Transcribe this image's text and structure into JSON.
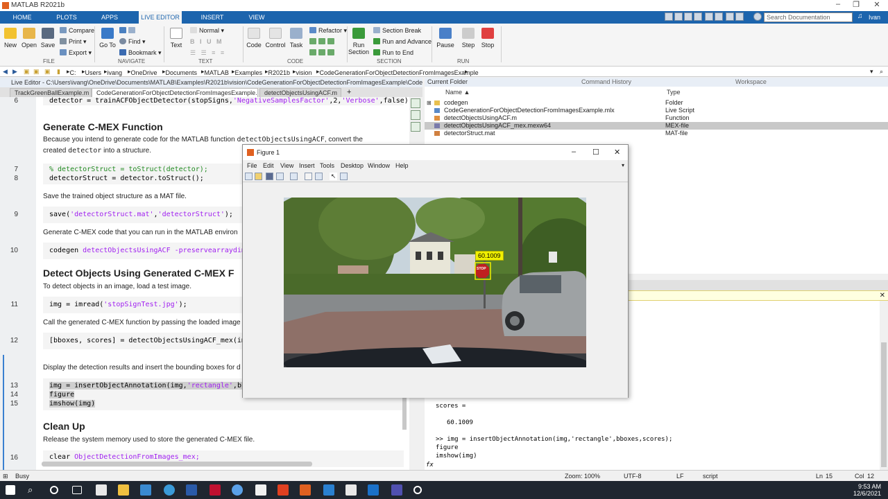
{
  "window": {
    "title": "MATLAB R2021b"
  },
  "ribbon_tabs": [
    "HOME",
    "PLOTS",
    "APPS",
    "LIVE EDITOR",
    "INSERT",
    "VIEW"
  ],
  "search_placeholder": "Search Documentation",
  "user": "Ivan",
  "ribbon": {
    "file": {
      "new": "New",
      "open": "Open",
      "save": "Save",
      "compare": "Compare",
      "print": "Print",
      "export": "Export",
      "group": "FILE"
    },
    "navigate": {
      "goto": "Go To",
      "find": "Find",
      "bookmark": "Bookmark",
      "group": "NAVIGATE"
    },
    "text": {
      "style": "Normal",
      "label": "Text",
      "group": "TEXT"
    },
    "code": {
      "code": "Code",
      "control": "Control",
      "task": "Task",
      "refactor": "Refactor",
      "group": "CODE"
    },
    "section": {
      "run_section": "Run Section",
      "section_break": "Section Break",
      "run_advance": "Run and Advance",
      "run_end": "Run to End",
      "group": "SECTION"
    },
    "run": {
      "pause": "Pause",
      "step": "Step",
      "stop": "Stop",
      "group": "RUN"
    }
  },
  "address_path": [
    "C:",
    "Users",
    "ivang",
    "OneDrive",
    "Documents",
    "MATLAB",
    "Examples",
    "R2021b",
    "vision",
    "CodeGenerationForObjectDetectionFromImagesExample"
  ],
  "editor": {
    "title": "Live Editor - C:\\Users\\ivang\\OneDrive\\Documents\\MATLAB\\Examples\\R2021b\\vision\\CodeGenerationForObjectDetectionFromImagesExample\\CodeGenerati...",
    "tabs": [
      "TrackGreenBallExample.m",
      "CodeGenerationForObjectDetectionFromImagesExample.mlx",
      "detectObjectsUsingACF.m"
    ],
    "line6": "detector = trainACFObjectDetector(stopSigns,",
    "line6_s1": "'NegativeSamplesFactor'",
    "line6_mid": ",2,",
    "line6_s2": "'Verbose'",
    "line6_end": ",false);",
    "h_generate": "Generate C-MEX Function",
    "p1a": "Because you intend to generate code for the MATLAB function",
    "p1_code": "detectObjectsUsingACF",
    "p1b": ", convert the",
    "p1c": "created",
    "p1_code2": "detector",
    "p1d": "into a structure.",
    "line7": "% detectorStruct = toStruct(detector);",
    "line8": "detectorStruct = detector.toStruct();",
    "p2": "Save the trained object structure as a MAT file.",
    "line9a": "save(",
    "line9_s1": "'detectorStruct.mat'",
    "line9_mid": ",",
    "line9_s2": "'detectorStruct'",
    "line9_end": ");",
    "p3": "Generate C-MEX code that you can run in the MATLAB environ",
    "line10a": "codegen ",
    "line10_s": "detectObjectsUsingACF -preservearraydims",
    "h_detect": "Detect Objects Using Generated C-MEX F",
    "p4": "To detect objects in an image, load a test image.",
    "line11a": "img = imread(",
    "line11_s": "'stopSignTest.jpg'",
    "line11_end": ");",
    "p5": "Call the generated C-MEX function by passing the loaded image",
    "line12": "[bboxes, scores] = detectObjectsUsingACF_mex(img);",
    "p6": "Display the detection results and insert the bounding boxes for d",
    "line13a": "img = insertObjectAnnotation(img,",
    "line13_s": "'rectangle'",
    "line13_end": ",bboxe",
    "line14": "figure",
    "line15": "imshow(img)",
    "h_clean": "Clean Up",
    "p7": "Release the system memory used to store the generated C-MEX file.",
    "line16a": "clear ",
    "line16_s": "ObjectDetectionFromImages_mex;",
    "line_numbers": [
      "6",
      "7",
      "8",
      "9",
      "10",
      "11",
      "12",
      "13",
      "14",
      "15",
      "16"
    ]
  },
  "panels": {
    "current_folder": "Current Folder",
    "command_history": "Command History",
    "workspace": "Workspace"
  },
  "folder": {
    "col_name": "Name ▲",
    "col_type": "Type",
    "files": [
      {
        "name": "codegen",
        "type": "Folder"
      },
      {
        "name": "CodeGenerationForObjectDetectionFromImagesExample.mlx",
        "type": "Live Script"
      },
      {
        "name": "detectObjectsUsingACF.m",
        "type": "Function"
      },
      {
        "name": "detectObjectsUsingACF_mex.mexw64",
        "type": "MEX-file"
      },
      {
        "name": "detectorStruct.mat",
        "type": "MAT-file"
      }
    ]
  },
  "command_window": {
    "scores_label": "scores =",
    "scores_value": "60.1009",
    "cmd1": ">> img = insertObjectAnnotation(img,'rectangle',bboxes,scores);",
    "cmd2": "figure",
    "cmd3": "imshow(img)",
    "prompt": "fx"
  },
  "figure": {
    "title": "Figure 1",
    "menu": [
      "File",
      "Edit",
      "View",
      "Insert",
      "Tools",
      "Desktop",
      "Window",
      "Help"
    ],
    "annotation_label": "60.1009",
    "stop_text": "STOP"
  },
  "status": {
    "state": "Busy",
    "zoom": "Zoom: 100%",
    "encoding": "UTF-8",
    "eol": "LF",
    "type": "script",
    "ln": "Ln",
    "ln_val": "15",
    "col": "Col",
    "col_val": "12"
  },
  "clock": {
    "time": "9:53 AM",
    "date": "12/6/2021"
  }
}
